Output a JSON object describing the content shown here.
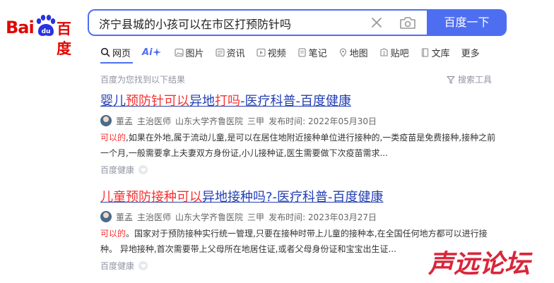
{
  "logo": {
    "part1": "Bai",
    "part2": "百度",
    "paw_letters": "du"
  },
  "search": {
    "query": "济宁县城的小孩可以在市区打预防针吗",
    "button_label": "百度一下"
  },
  "tabs": [
    {
      "label": "网页",
      "icon": "search-icon"
    },
    {
      "label": "Ai",
      "icon": "ai-sparkle-icon"
    },
    {
      "label": "图片",
      "icon": "image-icon"
    },
    {
      "label": "资讯",
      "icon": "news-icon"
    },
    {
      "label": "视频",
      "icon": "video-icon"
    },
    {
      "label": "笔记",
      "icon": "note-icon"
    },
    {
      "label": "地图",
      "icon": "map-icon"
    },
    {
      "label": "贴吧",
      "icon": "tieba-icon"
    },
    {
      "label": "文库",
      "icon": "library-icon"
    },
    {
      "label": "更多",
      "icon": ""
    }
  ],
  "result_count": "百度为您找到以下结果",
  "search_tools": "搜索工具",
  "results": [
    {
      "title_parts": [
        {
          "text": "婴儿",
          "hl": false
        },
        {
          "text": "预防针可以",
          "hl": true
        },
        {
          "text": "异地",
          "hl": false
        },
        {
          "text": "打吗",
          "hl": true
        },
        {
          "text": "-医疗科普-百度健康",
          "hl": false
        }
      ],
      "author": "董孟",
      "title": "主治医师",
      "hospital": "山东大学齐鲁医院",
      "level": "三甲",
      "published": "发布时间: 2022年05月30日",
      "abstract_hl": "可以的",
      "abstract_rest": ",如果在外地,属于流动儿童,是可以在居住地附近接种单位进行接种的,一类疫苗是免费接种,接种之前一个月,一般需要拿上夫妻双方身份证,小儿接种证,医生需要做下次疫苗需求...",
      "source": "百度健康"
    },
    {
      "title_parts": [
        {
          "text": "儿童预防接种可以",
          "hl": true
        },
        {
          "text": "异地接种吗?-医疗科普-百度健康",
          "hl": false
        }
      ],
      "author": "董孟",
      "title": "主治医师",
      "hospital": "山东大学齐鲁医院",
      "level": "三甲",
      "published": "发布时间: 2023年03月27日",
      "abstract_hl": "可以的",
      "abstract_rest": "。国家对于预防接种实行统一管理,只要在接种时带上儿童的接种本,在全国任何地方都可以进行接种。 异地接种,首次需要带上父母所在地居住证,或者父母身份证和宝宝出生证...",
      "source": "百度健康"
    }
  ],
  "watermark": "声远论坛",
  "colors": {
    "accent": "#4e6ef2",
    "highlight": "#f73131",
    "link": "#2440b3",
    "brand_red": "#e10602",
    "watermark": "#d9263b"
  }
}
